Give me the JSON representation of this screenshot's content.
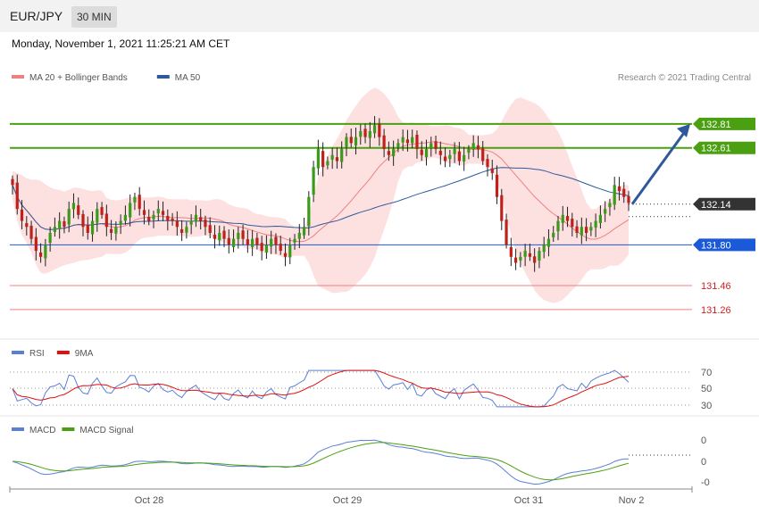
{
  "header": {
    "symbol": "EUR/JPY",
    "interval": "30 MIN",
    "datetime": "Monday, November 1, 2021 11:25:21 AM CET"
  },
  "legend": {
    "price": [
      {
        "name": "MA 20 + Bollinger Bands",
        "color": "#f08080"
      },
      {
        "name": "MA 50",
        "color": "#2e5a9c"
      }
    ],
    "rsi": [
      {
        "name": "RSI",
        "color": "#5b7fd6"
      },
      {
        "name": "9MA",
        "color": "#e01010"
      }
    ],
    "macd": [
      {
        "name": "MACD",
        "color": "#5b7fd6"
      },
      {
        "name": "MACD Signal",
        "color": "#4aa010"
      }
    ]
  },
  "credit": "Research © 2021 Trading Central",
  "colors": {
    "up": "#3a9a1a",
    "down": "#c0201a",
    "resistance": "#4aa010",
    "pivot": "#1a5ad8",
    "support": "#f08080",
    "current": "#333333",
    "arrow": "#2e5a9c"
  },
  "chart_data": {
    "type": "candlestick",
    "price_range": [
      131.05,
      133.1
    ],
    "levels": [
      {
        "label": "132.81",
        "value": 132.81,
        "role": "resistance"
      },
      {
        "label": "132.61",
        "value": 132.61,
        "role": "resistance"
      },
      {
        "label": "132.14",
        "value": 132.14,
        "role": "current"
      },
      {
        "label": "131.80",
        "value": 131.8,
        "role": "pivot"
      },
      {
        "label": "131.46",
        "value": 131.46,
        "role": "support"
      },
      {
        "label": "131.26",
        "value": 131.26,
        "role": "support"
      }
    ],
    "x_ticks": [
      "Oct 28",
      "Oct 29",
      "Oct 31",
      "Nov 2"
    ],
    "rsi_ticks": [
      "70",
      "50",
      "30"
    ],
    "macd_ticks": [
      "0",
      "0",
      "-0"
    ],
    "forecast_arrow": {
      "from": 132.14,
      "to": 132.81
    },
    "closes": [
      132.3,
      132.1,
      132.0,
      131.95,
      131.85,
      131.75,
      131.7,
      131.8,
      131.9,
      131.95,
      132.0,
      131.95,
      132.1,
      132.15,
      132.05,
      131.95,
      131.9,
      132.0,
      132.1,
      132.05,
      131.95,
      131.9,
      131.95,
      132.0,
      132.05,
      132.15,
      132.2,
      132.1,
      132.05,
      132.0,
      132.05,
      132.1,
      132.05,
      132.0,
      132.0,
      131.95,
      131.9,
      131.95,
      132.0,
      132.05,
      132.0,
      131.95,
      131.9,
      131.85,
      131.9,
      131.85,
      131.8,
      131.85,
      131.9,
      131.85,
      131.8,
      131.85,
      131.8,
      131.75,
      131.8,
      131.85,
      131.8,
      131.75,
      131.7,
      131.8,
      131.85,
      131.9,
      131.95,
      132.2,
      132.45,
      132.6,
      132.45,
      132.5,
      132.55,
      132.5,
      132.6,
      132.7,
      132.65,
      132.7,
      132.75,
      132.7,
      132.75,
      132.8,
      132.7,
      132.6,
      132.55,
      132.6,
      132.65,
      132.7,
      132.65,
      132.7,
      132.6,
      132.55,
      132.6,
      132.65,
      132.6,
      132.55,
      132.5,
      132.55,
      132.6,
      132.5,
      132.55,
      132.6,
      132.65,
      132.6,
      132.5,
      132.45,
      132.4,
      132.2,
      132.0,
      131.8,
      131.7,
      131.65,
      131.7,
      131.75,
      131.7,
      131.65,
      131.75,
      131.8,
      131.85,
      131.9,
      132.0,
      132.05,
      132.0,
      131.95,
      131.9,
      131.95,
      131.9,
      131.95,
      132.0,
      132.05,
      132.1,
      132.15,
      132.3,
      132.25,
      132.2,
      132.15
    ]
  }
}
